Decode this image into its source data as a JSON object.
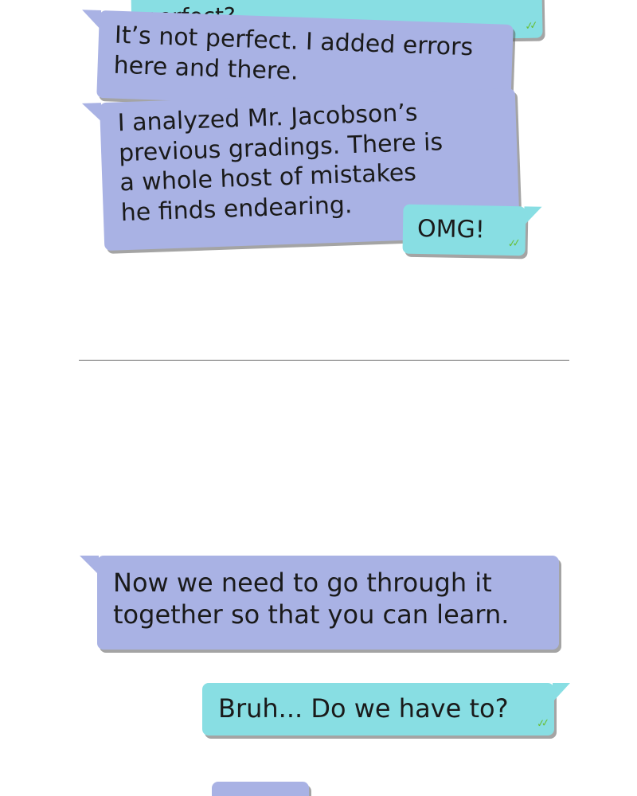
{
  "conversation": {
    "msg_cut_top": "perfect?",
    "msg_not_perfect": "It’s not perfect. I added errors\nhere and there.",
    "msg_analyzed": "I analyzed Mr. Jacobson’s\nprevious gradings. There is\na whole host of mistakes\nhe finds endearing.",
    "msg_omg": "OMG!",
    "msg_go_through": "Now we need to go through it\ntogether so that you can learn.",
    "msg_bruh": "Bruh... Do we have to?"
  },
  "colors": {
    "assistant_bubble": "#a9b2e4",
    "user_bubble": "#88dee3",
    "read_check": "#6abf3a"
  },
  "icons": {
    "read_receipt": "double-check-icon"
  }
}
